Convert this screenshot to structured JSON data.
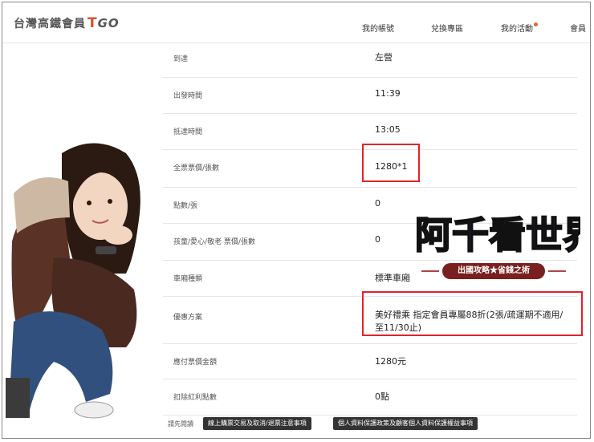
{
  "header": {
    "logo_text": "台灣高鐵會員",
    "logo_t": "T",
    "logo_go": "GO",
    "nav": [
      {
        "label": "我的帳號"
      },
      {
        "label": "兌換專區"
      },
      {
        "label": "我的活動"
      },
      {
        "label": "會員"
      }
    ]
  },
  "rows": [
    {
      "label": "到達",
      "value": "左營"
    },
    {
      "label": "出發時間",
      "value": "11:39"
    },
    {
      "label": "抵達時間",
      "value": "13:05"
    },
    {
      "label": "全票票價/張數",
      "value": "1280*1"
    },
    {
      "label": "點數/張",
      "value": "0"
    },
    {
      "label": "孩童/愛心/敬老 票價/張數",
      "value": "0"
    },
    {
      "label": "車廂種類",
      "value": "標準車廂"
    },
    {
      "label": "優惠方案",
      "value": "美好禮乘 指定會員專屬88折(2張/疏運期不適用/至11/30止)"
    },
    {
      "label": "應付票價金額",
      "value": "1280元"
    },
    {
      "label": "扣除紅利點數",
      "value": "0點"
    }
  ],
  "footer": {
    "hint": "請先閱讀",
    "btn1": "線上購票交易及取消/退票注意事項",
    "btn2": "個人資料保護政策及顧客個人資料保護權益事項"
  },
  "sticker": {
    "title": "阿千看世界",
    "subtitle": "出國攻略★省錢之術"
  },
  "colors": {
    "highlight": "#e0242b",
    "brand_orange": "#d9502a",
    "button_bg": "#333333"
  }
}
